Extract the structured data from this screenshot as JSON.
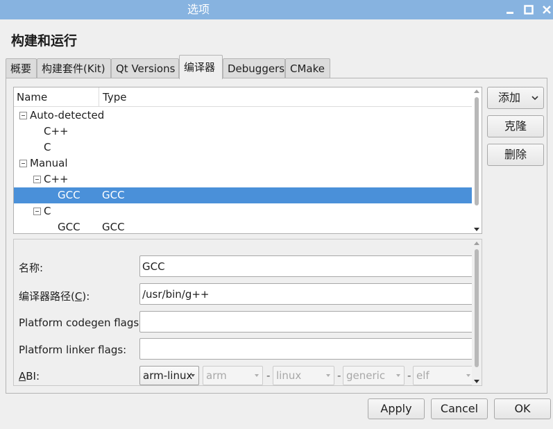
{
  "window": {
    "title": "选项",
    "titlebar_color": "#87b3e0"
  },
  "page": {
    "heading": "构建和运行"
  },
  "tabs": [
    {
      "label": "概要"
    },
    {
      "label": "构建套件(Kit)"
    },
    {
      "label": "Qt Versions"
    },
    {
      "label": "编译器",
      "active": true
    },
    {
      "label": "Debuggers"
    },
    {
      "label": "CMake"
    }
  ],
  "tree": {
    "columns": {
      "name": "Name",
      "type": "Type"
    },
    "rows": [
      {
        "name": "Auto-detected",
        "type": ""
      },
      {
        "name": "C++",
        "type": ""
      },
      {
        "name": "C",
        "type": ""
      },
      {
        "name": "Manual",
        "type": ""
      },
      {
        "name": "C++",
        "type": ""
      },
      {
        "name": "GCC",
        "type": "GCC",
        "selected": true
      },
      {
        "name": "C",
        "type": ""
      },
      {
        "name": "GCC",
        "type": "GCC"
      }
    ],
    "selection_color": "#4a90d9"
  },
  "side_buttons": {
    "add": "添加",
    "clone": "克隆",
    "remove": "删除"
  },
  "details": {
    "name_label": "名称:",
    "name_value": "GCC",
    "path_label_prefix": "编译器路径(",
    "path_label_key": "C",
    "path_label_suffix": "):",
    "path_value": "/usr/bin/g++",
    "codegen_label": "Platform codegen flags:",
    "codegen_value": "",
    "linker_label": "Platform linker flags:",
    "linker_value": "",
    "abi_label_key": "A",
    "abi_label_rest": "BI:",
    "abi": {
      "main": "arm-linux",
      "arch": "arm",
      "os": "linux",
      "flavor": "generic",
      "format": "elf",
      "separator": "-"
    }
  },
  "footer": {
    "apply": "Apply",
    "cancel": "Cancel",
    "ok": "OK"
  }
}
